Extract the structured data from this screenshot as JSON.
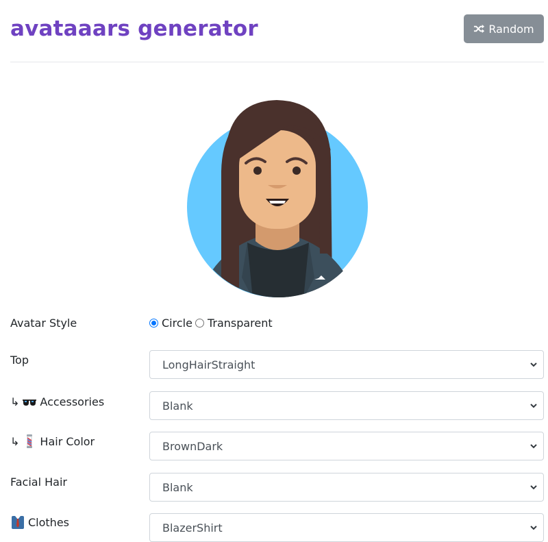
{
  "app": {
    "title": "avataaars generator",
    "random_label": "Random"
  },
  "icons": {
    "random": "shuffle-icon",
    "accessories": "sunglasses-icon",
    "hair_color": "barber-pole-icon",
    "clothes": "shirt-tie-icon"
  },
  "colors": {
    "title": "#6f42c1",
    "random_button": "#868e96",
    "avatar_background": "#65c9ff",
    "hair": "#4a312c",
    "skin": "#edb98a",
    "blazer": "#3c4f5c",
    "radio_accent": "#0075ff"
  },
  "form": {
    "avatar_style": {
      "label": "Avatar Style",
      "options": [
        "Circle",
        "Transparent"
      ],
      "selected": "Circle"
    },
    "top": {
      "label": "Top",
      "value": "LongHairStraight"
    },
    "accessories": {
      "prefix": "↳",
      "label": "Accessories",
      "value": "Blank"
    },
    "hair_color": {
      "prefix": "↳",
      "label": "Hair Color",
      "value": "BrownDark"
    },
    "facial_hair": {
      "label": "Facial Hair",
      "value": "Blank"
    },
    "clothes": {
      "label": "Clothes",
      "value": "BlazerShirt"
    }
  }
}
